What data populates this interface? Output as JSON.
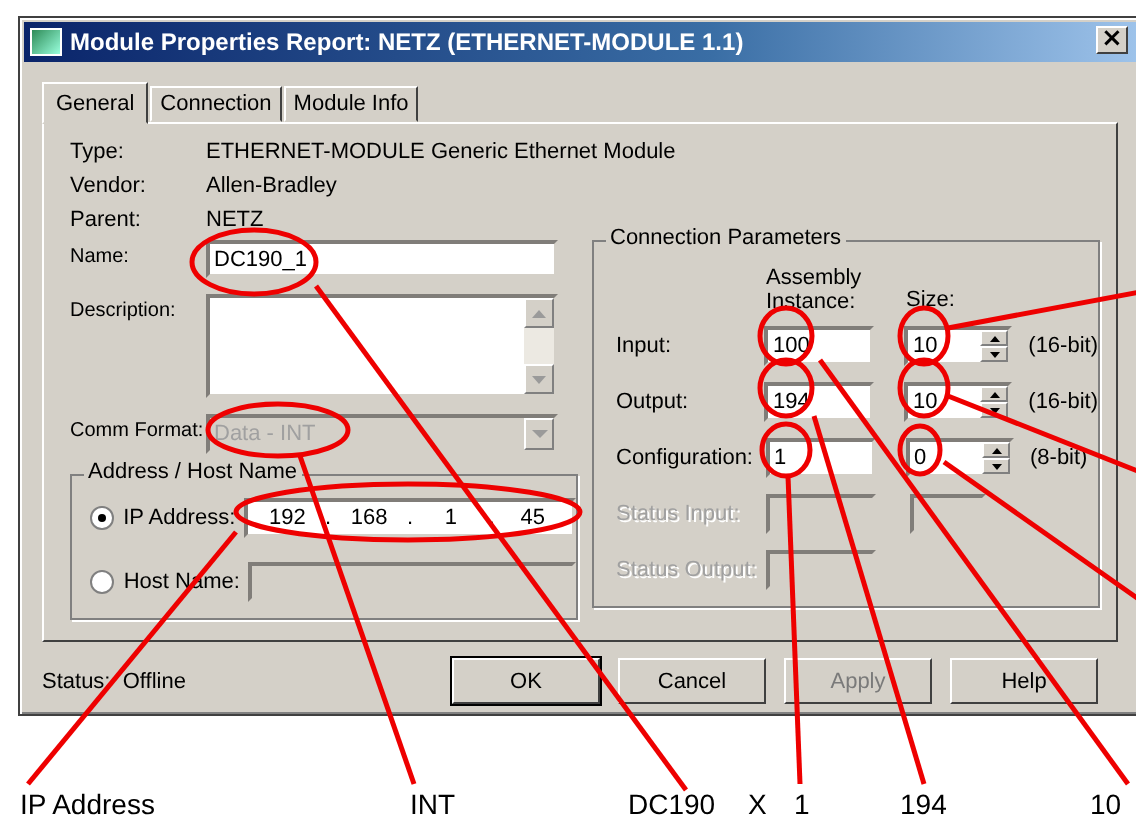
{
  "window": {
    "title": "Module Properties Report: NETZ (ETHERNET-MODULE 1.1)",
    "close": "×"
  },
  "tabs": [
    {
      "label": "General",
      "selected": true
    },
    {
      "label": "Connection",
      "selected": false
    },
    {
      "label": "Module Info",
      "selected": false
    }
  ],
  "info": [
    {
      "label": "Type:",
      "value": "ETHERNET-MODULE Generic Ethernet Module"
    },
    {
      "label": "Vendor:",
      "value": "Allen-Bradley"
    },
    {
      "label": "Parent:",
      "value": "NETZ"
    }
  ],
  "name": {
    "label": "Name:",
    "value": "DC190_1"
  },
  "description": {
    "label": "Description:"
  },
  "comm_format": {
    "label": "Comm Format:",
    "value": "Data - INT",
    "disabled": true
  },
  "address": {
    "title": "Address / Host Name",
    "options": [
      {
        "label": "IP Address:",
        "selected": true,
        "kind": "ip",
        "octets": [
          "192",
          "168",
          "1",
          "45"
        ],
        "separator": "."
      },
      {
        "label": "Host Name:",
        "selected": false,
        "kind": "host"
      }
    ]
  },
  "connection": {
    "title": "Connection Parameters",
    "instance_header": "Assembly Instance:",
    "size_header": "Size:",
    "rows": [
      {
        "kind": "param",
        "label": "Input:",
        "instance": "100",
        "size": "10",
        "unit": "(16-bit)"
      },
      {
        "kind": "param",
        "label": "Output:",
        "instance": "194",
        "size": "10",
        "unit": "(16-bit)"
      },
      {
        "kind": "param",
        "label": "Configuration:",
        "instance": "1",
        "size": "0",
        "unit": "(8-bit)"
      },
      {
        "kind": "status",
        "label": "Status Input:",
        "size_field": true
      },
      {
        "kind": "status",
        "label": "Status Output:",
        "size_field": false
      }
    ]
  },
  "status": {
    "label": "Status:",
    "value": "Offline"
  },
  "buttons": [
    {
      "label": "OK",
      "disabled": false,
      "default": true
    },
    {
      "label": "Cancel",
      "disabled": false,
      "default": false
    },
    {
      "label": "Apply",
      "disabled": true,
      "default": false
    },
    {
      "label": "Help",
      "disabled": false,
      "default": false
    }
  ],
  "annotations": [
    {
      "label": "IP Address"
    },
    {
      "label": "INT"
    },
    {
      "label": "DC190"
    },
    {
      "label": "X"
    },
    {
      "label": "1"
    },
    {
      "label": "194"
    },
    {
      "label": "10"
    }
  ]
}
